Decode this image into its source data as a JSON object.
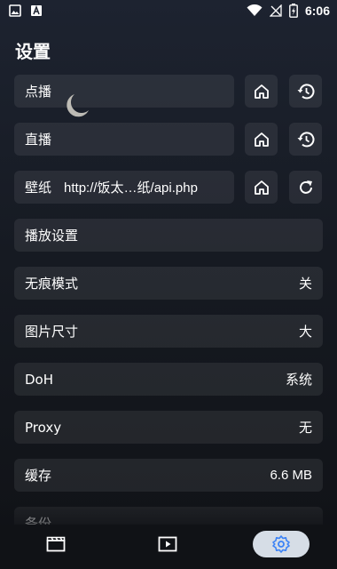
{
  "status_bar": {
    "time": "6:06",
    "icons": [
      "image-icon",
      "font-icon",
      "wifi-icon",
      "no-signal-icon",
      "battery-charging-icon"
    ]
  },
  "page": {
    "title": "设置"
  },
  "rows": {
    "vod": {
      "label": "点播",
      "icons": [
        "home-icon",
        "history-icon"
      ]
    },
    "live": {
      "label": "直播",
      "icons": [
        "home-icon",
        "history-icon"
      ]
    },
    "wallpaper": {
      "label": "壁纸",
      "url": "http://饭太…纸/api.php",
      "icons": [
        "home-icon",
        "refresh-icon"
      ]
    },
    "playback": {
      "label": "播放设置"
    },
    "incognito": {
      "label": "无痕模式",
      "value": "关"
    },
    "image_size": {
      "label": "图片尺寸",
      "value": "大"
    },
    "doh": {
      "label": "DoH",
      "value": "系统"
    },
    "proxy": {
      "label": "Proxy",
      "value": "无"
    },
    "cache": {
      "label": "缓存",
      "value": "6.6 MB"
    },
    "backup": {
      "label": "备份"
    }
  },
  "nav": {
    "items": [
      "film-icon",
      "play-icon",
      "settings-icon"
    ],
    "active": "settings-icon"
  },
  "colors": {
    "background": "#161a22",
    "card": "#262b33",
    "nav_active": "#d6dde6",
    "nav_active_icon": "#3b82f6"
  }
}
